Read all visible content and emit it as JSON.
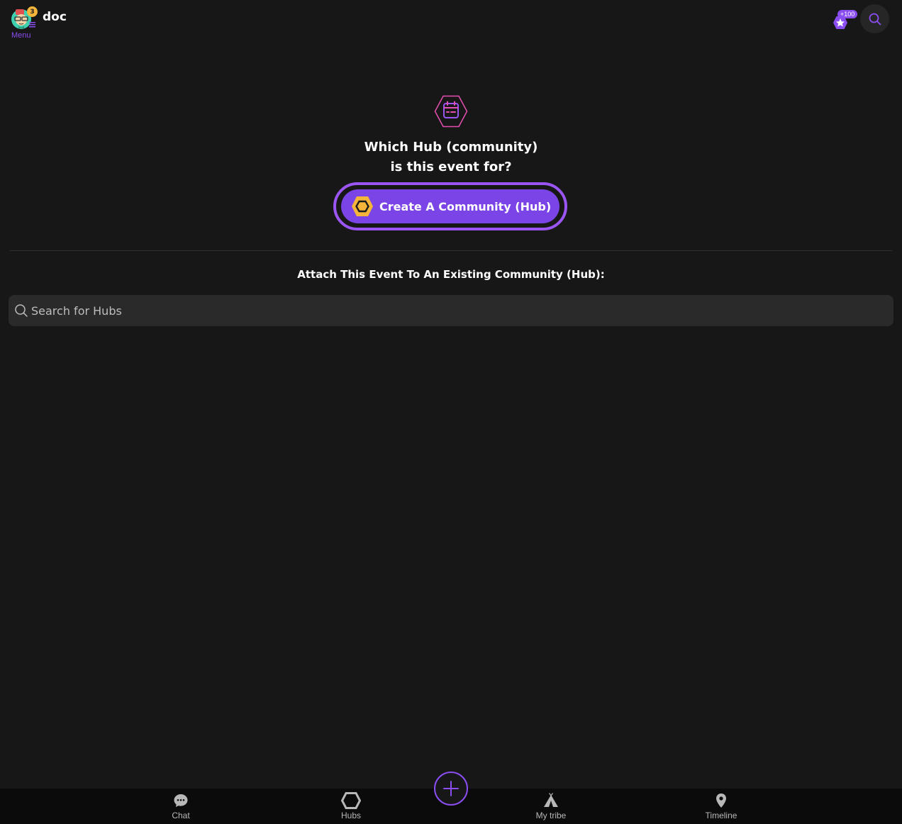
{
  "header": {
    "username": "doc",
    "menu_label": "Menu",
    "notification_count": "3",
    "points_badge": "+100"
  },
  "main": {
    "question_line1": "Which Hub (community)",
    "question_line2": "is this event for?",
    "create_button_label": "Create A Community (Hub)",
    "attach_title": "Attach This Event To An Existing Community (Hub):",
    "search": {
      "placeholder": "Search for Hubs",
      "value": ""
    }
  },
  "bottom_nav": {
    "items": [
      {
        "label": "Chat",
        "icon": "chat-bubble-icon"
      },
      {
        "label": "Hubs",
        "icon": "hexagon-hub-icon"
      },
      {
        "label": "My tribe",
        "icon": "tent-icon"
      },
      {
        "label": "Timeline",
        "icon": "map-pin-icon"
      }
    ],
    "fab_icon": "plus-icon"
  },
  "colors": {
    "background": "#171717",
    "accent_purple": "#8a4df0",
    "button_purple": "#7b44e6",
    "hub_yellow": "#f5b53a",
    "calendar_pink": "#e64fb0"
  }
}
